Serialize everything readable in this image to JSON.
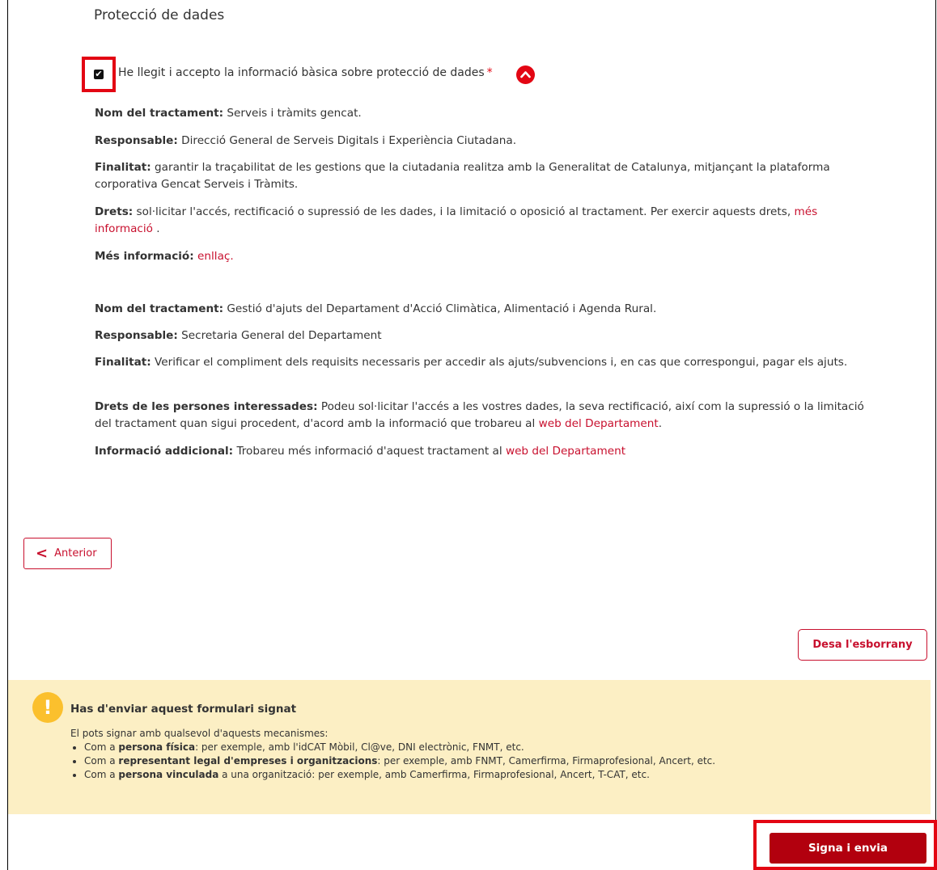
{
  "section": {
    "title": "Protecció de dades"
  },
  "consent": {
    "checked": true,
    "label": "He llegit i accepto la informació bàsica sobre protecció de dades",
    "required_mark": "*",
    "toggle_icon": "chevron-up-icon"
  },
  "treatment1": {
    "name_label": "Nom del tractament:",
    "name_value": " Serveis i tràmits gencat.",
    "resp_label": "Responsable:",
    "resp_value": " Direcció General de Serveis Digitals i Experiència Ciutadana.",
    "purpose_label": "Finalitat:",
    "purpose_value": " garantir la traçabilitat de les gestions que la ciutadania realitza amb la Generalitat de Catalunya, mitjançant la plataforma corporativa Gencat Serveis i Tràmits.",
    "rights_label": "Drets:",
    "rights_value": " sol·licitar l'accés, rectificació o supressió de les dades, i la limitació o oposició al tractament. Per exercir aquests drets, ",
    "rights_link": "més informació",
    "rights_tail": " .",
    "more_label": "Més informació:",
    "more_link": "enllaç."
  },
  "treatment2": {
    "name_label": "Nom del tractament:",
    "name_value": " Gestió d'ajuts del Departament d'Acció Climàtica, Alimentació i Agenda Rural.",
    "resp_label": "Responsable:",
    "resp_value": " Secretaria General del Departament",
    "purpose_label": "Finalitat:",
    "purpose_value": " Verificar el compliment dels requisits necessaris per accedir als ajuts/subvencions i, en cas que correspongui, pagar els ajuts.",
    "rights_label": "Drets de les persones interessades:",
    "rights_value": " Podeu sol·licitar l'accés a les vostres dades, la seva rectificació, així com la supressió o la limitació del tractament quan sigui procedent, d'acord amb la informació que trobareu al ",
    "rights_link": "web del Departament",
    "rights_tail": ".",
    "extra_label": "Informació addicional:",
    "extra_value": " Trobareu més informació d'aquest tractament al ",
    "extra_link": "web del Departament"
  },
  "nav": {
    "prev_label": "Anterior",
    "save_draft_label": "Desa l'esborrany",
    "sign_label": "Signa i envia"
  },
  "notice": {
    "icon": "exclamation-icon",
    "title": "Has d'enviar aquest formulari signat",
    "intro": "El pots signar amb qualsevol d'aquests mecanismes:",
    "items": [
      {
        "prefix": "Com a ",
        "bold": "persona física",
        "suffix": ": per exemple, amb l'idCAT Mòbil, Cl@ve, DNI electrònic, FNMT, etc."
      },
      {
        "prefix": "Com a ",
        "bold": "representant legal d'empreses i organitzacions",
        "suffix": ": per exemple, amb FNMT, Camerfirma, Firmaprofesional, Ancert, etc."
      },
      {
        "prefix": "Com a ",
        "bold": "persona vinculada",
        "suffix": " a una organització: per exemple, amb Camerfirma, Firmaprofesional, Ancert, T-CAT, etc."
      }
    ]
  },
  "colors": {
    "accent": "#c8102e",
    "sign_button": "#b2000e",
    "notice_bg": "#fcefc4",
    "notice_icon": "#fbc02d",
    "highlight": "#e30613"
  }
}
